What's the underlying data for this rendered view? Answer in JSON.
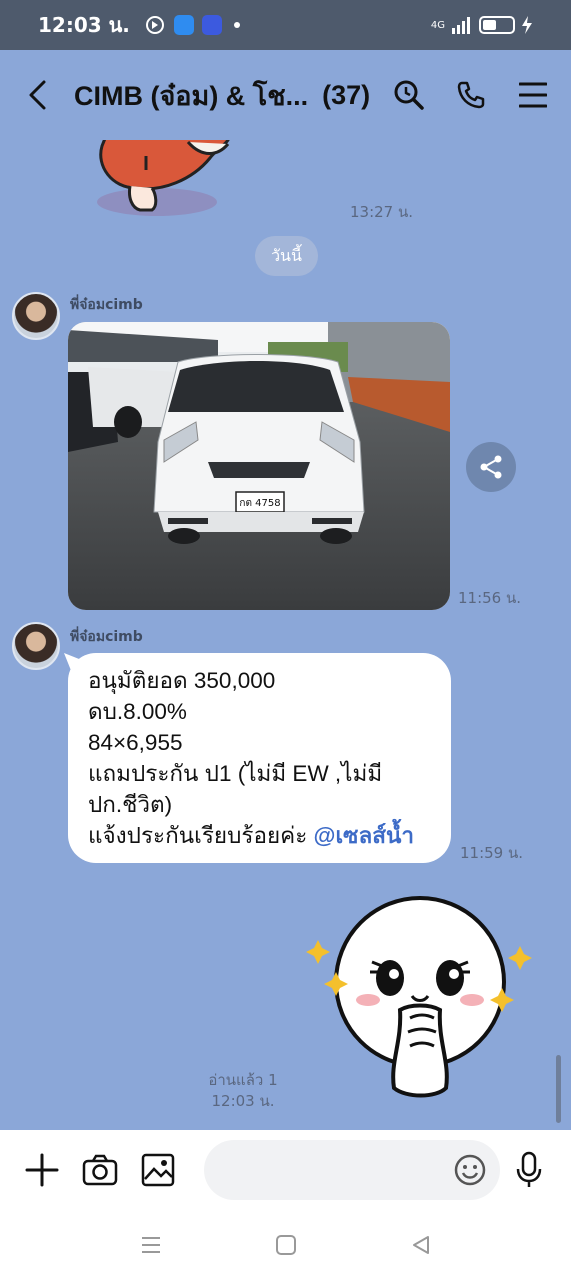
{
  "status_bar": {
    "time": "12:03 น.",
    "network": "4G",
    "battery_level": 0.45
  },
  "header": {
    "title": "CIMB (จ๋อม) & โช...",
    "member_count": "(37)",
    "icons": [
      "back-chevron-icon",
      "search-icon",
      "phone-icon",
      "menu-icon"
    ]
  },
  "chat": {
    "sticker_time": "13:27 น.",
    "date_divider": "วันนี้",
    "messages": [
      {
        "sender": "พี่จ๋อมcimb",
        "type": "image",
        "description_label": "",
        "plate": "กต 4758",
        "time": "11:56 น."
      },
      {
        "sender": "พี่จ๋อมcimb",
        "type": "text",
        "lines": [
          "อนุมัติยอด 350,000",
          "ดบ.8.00%",
          "84×6,955",
          "แถมประกัน ป1 (ไม่มี EW ,ไม่มี",
          "ปก.ชีวิต)"
        ],
        "last_line_prefix": "แจ้งประกันเรียบร้อยค่ะ ",
        "mention": "@เซลส์น้ำ",
        "time": "11:59 น."
      }
    ],
    "read_status": "อ่านแล้ว 1",
    "last_time": "12:03 น."
  },
  "input_bar": {
    "placeholder": "",
    "icons": [
      "plus-icon",
      "camera-icon",
      "image-icon",
      "emoji-icon",
      "microphone-icon"
    ]
  },
  "nav_bar": {
    "icons": [
      "recent-apps-icon",
      "home-icon",
      "back-icon"
    ]
  },
  "colors": {
    "chat_background": "#8ba7d8",
    "status_bar": "#4e5a6c",
    "mention": "#3d6bc7"
  }
}
